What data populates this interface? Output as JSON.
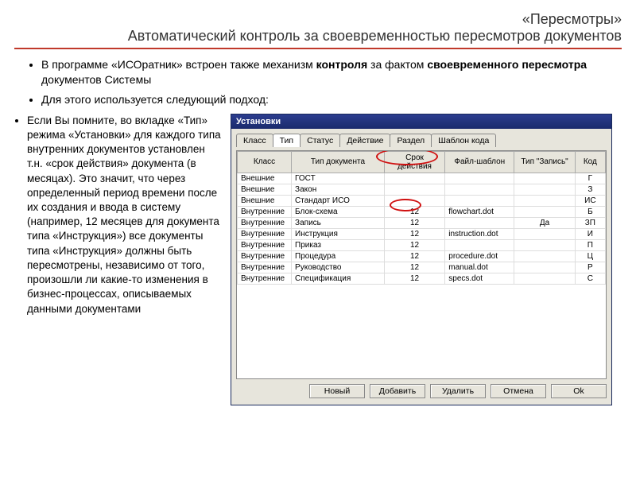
{
  "suptitle": "«Пересмотры»",
  "title": "Автоматический контроль за своевременностью пересмотров документов",
  "bullets": {
    "b1": "В программе «ИСОратник» встроен также механизм ",
    "b1_bold": "контроля",
    "b1_mid": " за фактом ",
    "b1_bold2": "своевременного пересмотра",
    "b1_tail": " документов Системы",
    "b2": "Для этого используется следующий подход:"
  },
  "leftpara": "Если Вы помните, во вкладке «Тип» режима «Установки» для каждого типа внутренних документов установлен т.н. «срок действия» документа (в месяцах). Это значит, что через определенный период времени после их создания и ввода в систему (например, 12 месяцев для документа типа «Инструкция») все документы типа «Инструкция» должны быть пересмотрены, независимо от того, произошли ли какие-то изменения в бизнес-процессах, описываемых данными документами",
  "window": {
    "title": "Установки",
    "tabs": [
      "Класс",
      "Тип",
      "Статус",
      "Действие",
      "Раздел",
      "Шаблон кода"
    ],
    "activeTab": 1,
    "headers": [
      "Класс",
      "Тип документа",
      "Срок действия",
      "Файл-шаблон",
      "Тип \"Запись\"",
      "Код"
    ],
    "rows": [
      {
        "c0": "Внешние",
        "c1": "ГОСТ",
        "c2": "",
        "c3": "",
        "c4": "",
        "c5": "Г"
      },
      {
        "c0": "Внешние",
        "c1": "Закон",
        "c2": "",
        "c3": "",
        "c4": "",
        "c5": "З"
      },
      {
        "c0": "Внешние",
        "c1": "Стандарт ИСО",
        "c2": "",
        "c3": "",
        "c4": "",
        "c5": "ИС"
      },
      {
        "c0": "Внутренние",
        "c1": "Блок-схема",
        "c2": "12",
        "c3": "flowchart.dot",
        "c4": "",
        "c5": "Б"
      },
      {
        "c0": "Внутренние",
        "c1": "Запись",
        "c2": "12",
        "c3": "",
        "c4": "Да",
        "c5": "ЗП"
      },
      {
        "c0": "Внутренние",
        "c1": "Инструкция",
        "c2": "12",
        "c3": "instruction.dot",
        "c4": "",
        "c5": "И"
      },
      {
        "c0": "Внутренние",
        "c1": "Приказ",
        "c2": "12",
        "c3": "",
        "c4": "",
        "c5": "П"
      },
      {
        "c0": "Внутренние",
        "c1": "Процедура",
        "c2": "12",
        "c3": "procedure.dot",
        "c4": "",
        "c5": "Ц"
      },
      {
        "c0": "Внутренние",
        "c1": "Руководство",
        "c2": "12",
        "c3": "manual.dot",
        "c4": "",
        "c5": "Р"
      },
      {
        "c0": "Внутренние",
        "c1": "Спецификация",
        "c2": "12",
        "c3": "specs.dot",
        "c4": "",
        "c5": "С"
      }
    ],
    "buttons": {
      "new": "Новый",
      "add": "Добавить",
      "delete": "Удалить",
      "cancel": "Отмена",
      "ok": "Ok"
    }
  }
}
